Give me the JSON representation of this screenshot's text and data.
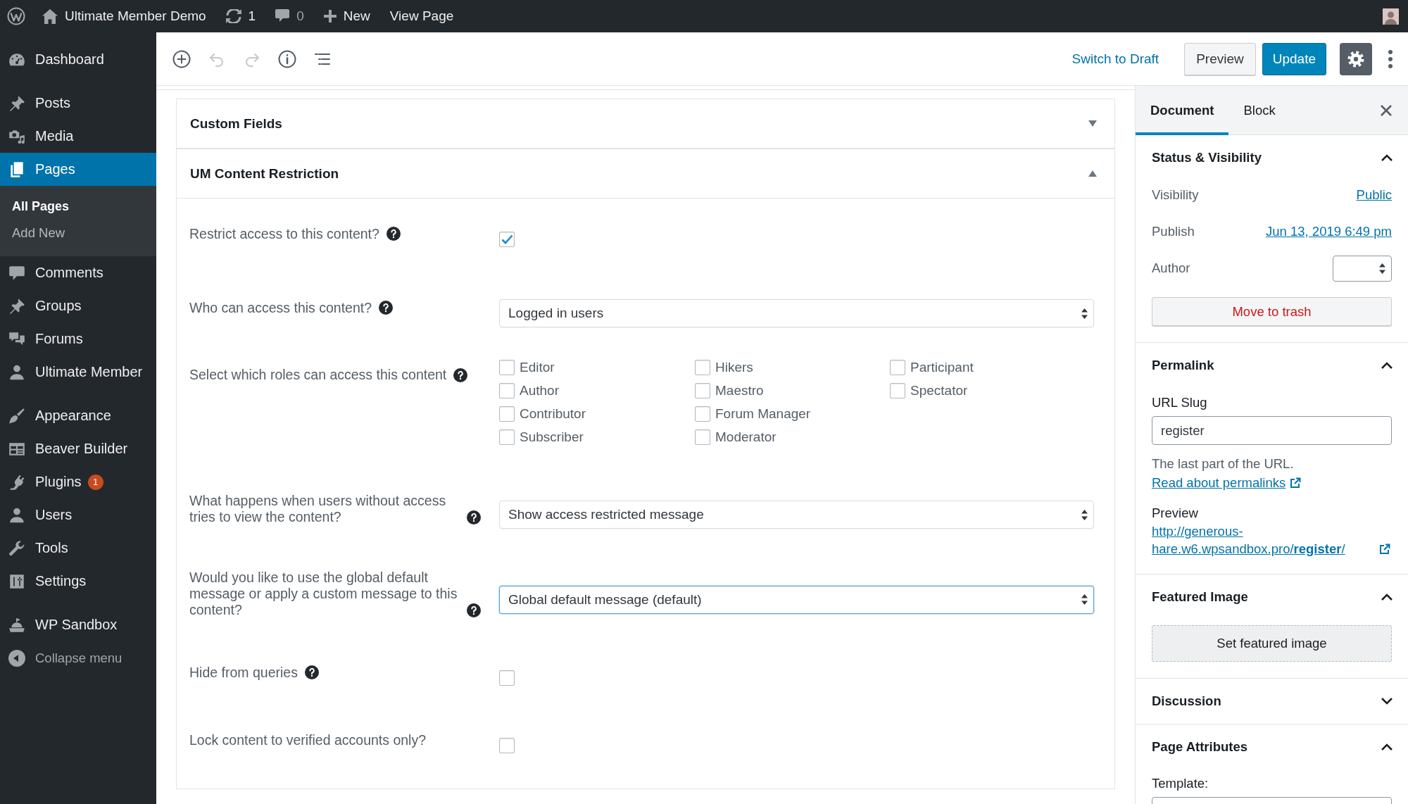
{
  "admin_bar": {
    "site_name": "Ultimate Member Demo",
    "updates": "1",
    "comments": "0",
    "new": "New",
    "view_page": "View Page"
  },
  "menu": {
    "groups": [
      {
        "items": [
          {
            "label": "Dashboard",
            "selected": false
          }
        ]
      },
      {
        "items": [
          {
            "label": "Posts",
            "selected": false
          },
          {
            "label": "Media",
            "selected": false
          },
          {
            "label": "Pages",
            "selected": true,
            "children": [
              {
                "label": "All Pages",
                "selected": true
              },
              {
                "label": "Add New",
                "selected": false
              }
            ]
          },
          {
            "label": "Comments",
            "selected": false
          },
          {
            "label": "Groups",
            "selected": false
          },
          {
            "label": "Forums",
            "selected": false
          },
          {
            "label": "Ultimate Member",
            "selected": false
          }
        ]
      },
      {
        "items": [
          {
            "label": "Appearance",
            "selected": false
          },
          {
            "label": "Beaver Builder",
            "selected": false
          },
          {
            "label": "Plugins",
            "selected": false,
            "badge": "1"
          },
          {
            "label": "Users",
            "selected": false
          },
          {
            "label": "Tools",
            "selected": false
          },
          {
            "label": "Settings",
            "selected": false
          }
        ]
      },
      {
        "items": [
          {
            "label": "WP Sandbox",
            "selected": false
          }
        ]
      }
    ],
    "collapse": "Collapse menu"
  },
  "toolbar": {
    "tools": [
      {
        "disabled": false
      },
      {
        "disabled": true
      },
      {
        "disabled": true
      },
      {
        "disabled": false
      },
      {
        "disabled": false
      }
    ],
    "switch_to_draft": "Switch to Draft",
    "preview": "Preview",
    "update": "Update",
    "settings": {
      "selected": true
    }
  },
  "metaboxes": [
    {
      "title": "Custom Fields",
      "expanded": false
    },
    {
      "title": "UM Content Restriction",
      "expanded": true,
      "fields": [
        {
          "kind": "checkbox",
          "label": "Restrict access to this content?",
          "help": true,
          "checked": true
        },
        {
          "kind": "select",
          "label": "Who can access this content?",
          "help": true,
          "value": "Logged in users",
          "focused": false
        },
        {
          "kind": "checkbox_group",
          "label": "Select which roles can access this content",
          "help": true,
          "options": [
            {
              "label": "Editor",
              "checked": false
            },
            {
              "label": "Author",
              "checked": false
            },
            {
              "label": "Contributor",
              "checked": false
            },
            {
              "label": "Subscriber",
              "checked": false
            },
            {
              "label": "Hikers",
              "checked": false
            },
            {
              "label": "Maestro",
              "checked": false
            },
            {
              "label": "Forum Manager",
              "checked": false
            },
            {
              "label": "Moderator",
              "checked": false
            },
            {
              "label": "Participant",
              "checked": false
            },
            {
              "label": "Spectator",
              "checked": false
            }
          ]
        },
        {
          "kind": "select",
          "label": "What happens when users without access tries to view the content?",
          "help": true,
          "value": "Show access restricted message",
          "focused": false
        },
        {
          "kind": "select",
          "label": "Would you like to use the global default message or apply a custom message to this content?",
          "help": true,
          "value": "Global default message (default)",
          "focused": true
        },
        {
          "kind": "checkbox",
          "label": "Hide from queries",
          "help": true,
          "checked": false
        },
        {
          "kind": "checkbox",
          "label": "Lock content to verified accounts only?",
          "help": false,
          "checked": false
        }
      ]
    }
  ],
  "settings_sidebar": {
    "tabs": [
      {
        "label": "Document",
        "selected": true
      },
      {
        "label": "Block",
        "selected": false
      }
    ],
    "panels": [
      {
        "kind": "status",
        "title": "Status & Visibility",
        "expanded": true,
        "rows": [
          {
            "kind": "link",
            "label": "Visibility",
            "value": "Public"
          },
          {
            "kind": "link",
            "label": "Publish",
            "value": "Jun 13, 2019 6:49 pm"
          },
          {
            "kind": "select",
            "label": "Author"
          }
        ],
        "trash": "Move to trash"
      },
      {
        "kind": "permalink",
        "title": "Permalink",
        "expanded": true,
        "slug_label": "URL Slug",
        "slug": "register",
        "help": "The last part of the URL.",
        "help_link": "Read about permalinks",
        "preview_label": "Preview",
        "preview_url": "http://generous-hare.w6.wpsandbox.pro/**register**/"
      },
      {
        "kind": "featured_image",
        "title": "Featured Image",
        "expanded": true,
        "button": "Set featured image"
      },
      {
        "title": "Discussion",
        "expanded": false
      },
      {
        "kind": "attributes",
        "title": "Page Attributes",
        "expanded": true,
        "template_label": "Template:"
      }
    ]
  }
}
